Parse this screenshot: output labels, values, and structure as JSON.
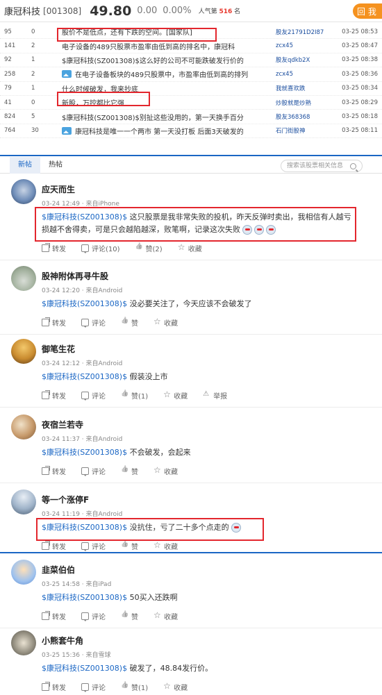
{
  "header": {
    "name": "康冠科技",
    "code": "[001308]",
    "price": "49.80",
    "change": "0.00",
    "percent": "0.00%",
    "pop_label": "人气第",
    "pop_rank": "516",
    "pop_unit": "名",
    "button_label": "回 我"
  },
  "table": [
    {
      "read": "95",
      "reply": "0",
      "title": "股价不是低点，还有下跌的空间。[国家队]",
      "author": "股友21791D2I87",
      "time": "03-25 08:53",
      "img": false
    },
    {
      "read": "141",
      "reply": "2",
      "title": "电子设备的489只股票市盈率由低到高的排名中，康冠科",
      "author": "zcx45",
      "time": "03-25 08:47",
      "img": false
    },
    {
      "read": "92",
      "reply": "1",
      "title": "$康冠科技(SZ001308)$这么好的公司不可能跌破发行价的",
      "author": "股友qdkb2X",
      "time": "03-25 08:38",
      "img": false
    },
    {
      "read": "258",
      "reply": "2",
      "title": "在电子设备板块的489只股票中，市盈率由低到高的排列",
      "author": "zcx45",
      "time": "03-25 08:36",
      "img": true
    },
    {
      "read": "79",
      "reply": "1",
      "title": "什么时候破发，我来抄底",
      "author": "我就喜欢跌",
      "time": "03-25 08:34",
      "img": false
    },
    {
      "read": "41",
      "reply": "0",
      "title": "新股，万控都比它强",
      "author": "炒股就是炒熟",
      "time": "03-25 08:29",
      "img": false
    },
    {
      "read": "824",
      "reply": "5",
      "title": "$康冠科技(SZ001308)$别扯这些没用的，第一天换手百分",
      "author": "股友368368",
      "time": "03-25 08:18",
      "img": false
    },
    {
      "read": "764",
      "reply": "30",
      "title": "康冠科技是唯一一个两市 第一天没打板 后面3天破发的",
      "author": "石门街股神",
      "time": "03-25 08:11",
      "img": true
    }
  ],
  "tabs": {
    "latest": "新帖",
    "hot": "热帖"
  },
  "search": {
    "placeholder": "搜索该股票相关信息"
  },
  "posts": [
    {
      "user": "应天而生",
      "meta": "03-24 12:49 · 来自iPhone",
      "stock": "$康冠科技(SZ001308)$",
      "text": " 这只股票是我非常失败的投机，昨天反弹时卖出，我相信有人越亏损越不舍得卖，可是只会越陷越深，败笔啊，记录这次失败",
      "share": "转发",
      "comment": "评论(10)",
      "like": "赞(2)",
      "fav": "收藏",
      "report": ""
    },
    {
      "user": "股神附体再寻牛股",
      "meta": "03-24 12:20 · 来自Android",
      "stock": "$康冠科技(SZ001308)$",
      "text": " 没必要关注了，今天应该不会破发了",
      "share": "转发",
      "comment": "评论",
      "like": "赞",
      "fav": "收藏",
      "report": ""
    },
    {
      "user": "御笔生花",
      "meta": "03-24 12:12 · 来自Android",
      "stock": "$康冠科技(SZ001308)$",
      "text": " 假装没上市",
      "share": "转发",
      "comment": "评论",
      "like": "赞(1)",
      "fav": "收藏",
      "report": "举报"
    },
    {
      "user": "夜宿兰若寺",
      "meta": "03-24 11:37 · 来自Android",
      "stock": "$康冠科技(SZ001308)$",
      "text": " 不会破发，会起来",
      "share": "转发",
      "comment": "评论",
      "like": "赞",
      "fav": "收藏",
      "report": ""
    },
    {
      "user": "等一个涨停F",
      "meta": "03-24 11:19 · 来自Android",
      "stock": "$康冠科技(SZ001308)$",
      "text": " 没抗住，亏了二十多个点走的",
      "share": "转发",
      "comment": "评论",
      "like": "赞",
      "fav": "收藏",
      "report": ""
    },
    {
      "user": "韭菜伯伯",
      "meta": "03-25 14:58 · 来自iPad",
      "stock": "$康冠科技(SZ001308)$",
      "text": " 50买入还跌啊",
      "share": "转发",
      "comment": "评论",
      "like": "赞",
      "fav": "收藏",
      "report": ""
    },
    {
      "user": "小熊套牛角",
      "meta": "03-25 15:36 · 来自雪球",
      "stock": "$康冠科技(SZ001308)$",
      "text": " 破发了，48.84发行价。",
      "share": "转发",
      "comment": "评论",
      "like": "赞(1)",
      "fav": "收藏",
      "report": ""
    }
  ],
  "colors": {
    "accent": "#1a66c4",
    "highlight": "#e3262d",
    "button": "#f5921f"
  }
}
